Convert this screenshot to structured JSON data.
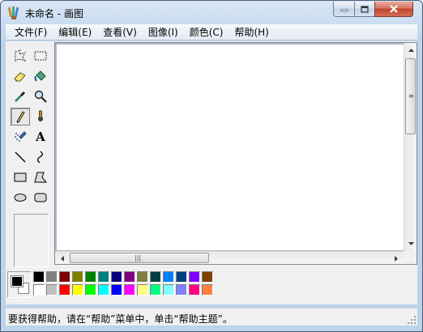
{
  "window": {
    "title": "未命名 - 画图",
    "icon": "paint-app-icon"
  },
  "caption_buttons": {
    "minimize": "minimize-icon",
    "maximize": "maximize-icon",
    "close": "close-icon"
  },
  "menubar": {
    "items": [
      {
        "label": "文件(F)"
      },
      {
        "label": "编辑(E)"
      },
      {
        "label": "查看(V)"
      },
      {
        "label": "图像(I)"
      },
      {
        "label": "颜色(C)"
      },
      {
        "label": "帮助(H)"
      }
    ]
  },
  "toolbox": {
    "tools": [
      {
        "name": "free-form-select",
        "icon": "free-form-select-icon"
      },
      {
        "name": "select",
        "icon": "rect-select-icon"
      },
      {
        "name": "eraser",
        "icon": "eraser-icon"
      },
      {
        "name": "fill-with-color",
        "icon": "paint-bucket-icon"
      },
      {
        "name": "pick-color",
        "icon": "eyedropper-icon"
      },
      {
        "name": "magnifier",
        "icon": "magnifier-icon"
      },
      {
        "name": "pencil",
        "icon": "pencil-icon",
        "selected": true
      },
      {
        "name": "brush",
        "icon": "brush-icon"
      },
      {
        "name": "airbrush",
        "icon": "airbrush-icon"
      },
      {
        "name": "text",
        "icon": "text-icon",
        "glyph": "A"
      },
      {
        "name": "line",
        "icon": "line-icon"
      },
      {
        "name": "curve",
        "icon": "curve-icon"
      },
      {
        "name": "rectangle",
        "icon": "rectangle-icon"
      },
      {
        "name": "polygon",
        "icon": "polygon-icon"
      },
      {
        "name": "ellipse",
        "icon": "ellipse-icon"
      },
      {
        "name": "rounded-rectangle",
        "icon": "rounded-rectangle-icon"
      }
    ]
  },
  "scrollbars": {
    "horizontal_grip": "|||",
    "vertical_grip": "≡"
  },
  "palette": {
    "foreground": "#000000",
    "background": "#ffffff",
    "row1": [
      "#000000",
      "#808080",
      "#800000",
      "#808000",
      "#008000",
      "#008080",
      "#000080",
      "#800080",
      "#808040",
      "#004040",
      "#0080ff",
      "#004080",
      "#8000ff",
      "#804000"
    ],
    "row2": [
      "#ffffff",
      "#c0c0c0",
      "#ff0000",
      "#ffff00",
      "#00ff00",
      "#00ffff",
      "#0000ff",
      "#ff00ff",
      "#ffff80",
      "#00ff80",
      "#80ffff",
      "#8080ff",
      "#ff0080",
      "#ff8040"
    ]
  },
  "statusbar": {
    "text": "要获得帮助，请在“帮助”菜单中，单击“帮助主题”。"
  }
}
